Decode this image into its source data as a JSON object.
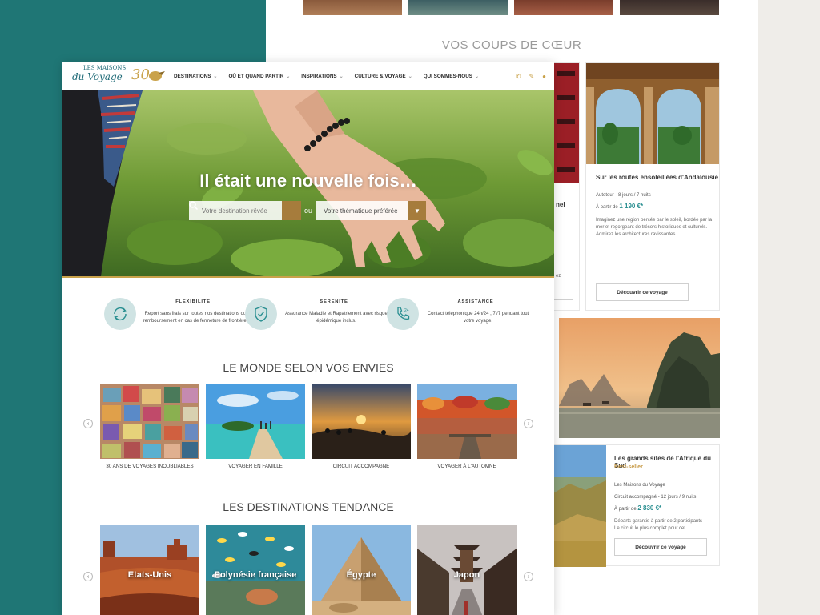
{
  "back_page": {
    "heading": "VOS COUPS DE CŒUR",
    "partial_card_left": {
      "title_fragment": "nel",
      "desc_fragment": "ez"
    },
    "card_andalousie": {
      "title": "Sur les routes ensoleillées d'Andalousie",
      "meta": "Autotour - 8 jours / 7 nuits",
      "price_prefix": "À partir de",
      "price": "1 190 €*",
      "description": "Imaginez une région bercée par le soleil, bordée par la mer et regorgeant de trésors historiques et culturels. Admirez les architectures ravissantes…",
      "button": "Découvrir ce voyage"
    },
    "card_afrique": {
      "title": "Les grands sites de l'Afrique du Sud",
      "badge": "Best-seller",
      "operator": "Les Maisons du Voyage",
      "meta": "Circuit accompagné - 12 jours / 9 nuits",
      "price_prefix": "À partir de",
      "price": "2 830 €*",
      "description": "Départs garantis à partir de 2 participants\nLe circuit le plus complet pour cet…",
      "button": "Découvrir ce voyage"
    }
  },
  "front_page": {
    "logo": {
      "line1": "LES MAISONS",
      "line2": "du Voyage",
      "anniversary": "30"
    },
    "nav": [
      {
        "label": "DESTINATIONS"
      },
      {
        "label": "OÙ ET QUAND PARTIR"
      },
      {
        "label": "INSPIRATIONS"
      },
      {
        "label": "CULTURE & VOYAGE"
      },
      {
        "label": "QUI SOMMES-NOUS"
      }
    ],
    "nav_icons": [
      "phone-icon",
      "pencil-icon",
      "user-icon"
    ],
    "hero": {
      "title": "Il était une nouvelle fois…",
      "destination_placeholder": "Votre destination rêvée",
      "or": "ou",
      "theme_placeholder": "Votre thématique préférée"
    },
    "features": [
      {
        "title": "FLEXIBILITÉ",
        "text": "Report sans frais sur toutes nos destinations ou remboursement en cas de fermeture de frontière.",
        "icon": "refresh-icon"
      },
      {
        "title": "SÉRÉNITÉ",
        "text": "Assurance Maladie et Rapatriement avec risque épidémique inclus.",
        "icon": "shield-check-icon"
      },
      {
        "title": "ASSISTANCE",
        "text": "Contact téléphonique 24h/24 , 7j/7 pendant tout votre voyage.",
        "icon": "phone-24-icon"
      }
    ],
    "section_envies": {
      "title": "LE MONDE SELON VOS ENVIES",
      "tiles": [
        {
          "label": "30 ANS DE VOYAGES INOUBLIABLES"
        },
        {
          "label": "VOYAGER EN FAMILLE"
        },
        {
          "label": "CIRCUIT ACCOMPAGNÉ"
        },
        {
          "label": "VOYAGER À L'AUTOMNE"
        }
      ]
    },
    "section_tendance": {
      "title": "LES DESTINATIONS TENDANCE",
      "tiles": [
        {
          "label": "Etats-Unis"
        },
        {
          "label": "Polynésie française"
        },
        {
          "label": "Égypte"
        },
        {
          "label": "Japon"
        }
      ]
    }
  },
  "colors": {
    "teal_background": "#1f7675",
    "accent_gold": "#c9a24a",
    "search_button": "#a67c3c",
    "price_teal": "#2a8f91"
  }
}
